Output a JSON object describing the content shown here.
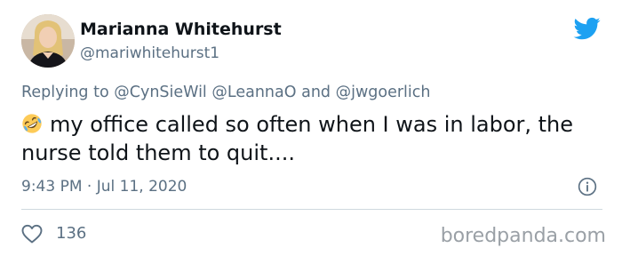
{
  "author": {
    "name": "Marianna Whitehurst",
    "handle": "@mariwhitehurst1"
  },
  "icons": {
    "logo": "twitter-bird-icon",
    "emoji": "rolling-on-floor-laughing-emoji",
    "info": "info-icon",
    "like": "heart-icon"
  },
  "reply": {
    "prefix": "Replying to",
    "mention1": "@CynSieWil",
    "mention2": "@LeannaO",
    "conjunction": "and",
    "mention3": "@jwgoerlich"
  },
  "tweet": {
    "text": "my office called so often when I was in labor, the nurse told them to quit...."
  },
  "meta": {
    "timestamp": "9:43 PM · Jul 11, 2020"
  },
  "stats": {
    "likes": "136"
  },
  "watermark": "boredpanda.com",
  "colors": {
    "twitter_blue": "#1da1f2",
    "secondary_text": "#5b7083",
    "primary_text": "#0f1419",
    "divider": "#cfd9de"
  }
}
